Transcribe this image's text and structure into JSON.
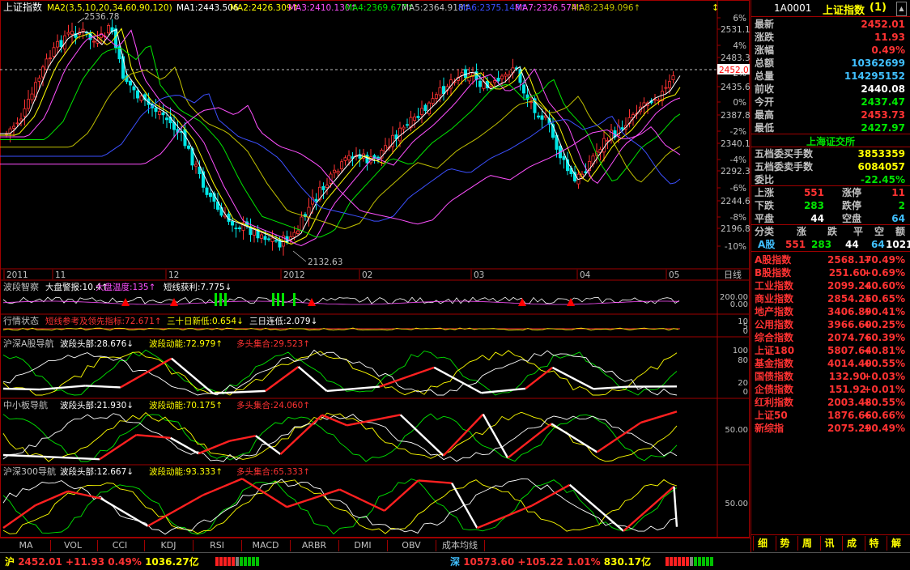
{
  "chart_title": "上证指数",
  "ma_legend": [
    {
      "text": "MA2(3,5,10,20,34,60,90,120)",
      "color": "#ffff00"
    },
    {
      "text": "MA1:2443.506",
      "color": "#ffffff"
    },
    {
      "text": "MA2:2426.309↑",
      "color": "#ffff00"
    },
    {
      "text": "MA3:2410.130↑",
      "color": "#ff50ff"
    },
    {
      "text": "MA4:2369.677↑",
      "color": "#00e600"
    },
    {
      "text": "MA5:2364.918↑",
      "color": "#c0c0c0"
    },
    {
      "text": "MA6:2375.148↑",
      "color": "#3c50ff"
    },
    {
      "text": "MA7:2326.574↑",
      "color": "#ff50ff"
    },
    {
      "text": "MA8:2349.096↑",
      "color": "#c0c000"
    }
  ],
  "price_labels": {
    "high": "2536.78",
    "low": "2132.63",
    "current": "2452.0"
  },
  "right_axis": [
    "6%",
    "2531.1",
    "4%",
    "2483.3",
    "2%",
    "2435.6",
    "0%",
    "2387.8",
    "-2%",
    "2340.1",
    "-4%",
    "2292.3",
    "-6%",
    "2244.6",
    "-8%",
    "2196.8",
    "-10%"
  ],
  "x_labels": [
    "2011",
    "11",
    "12",
    "2012",
    "02",
    "03",
    "04",
    "05"
  ],
  "timeframe": "日线",
  "indicators": [
    {
      "title": "波段智察",
      "items": [
        {
          "t": "大盘警报:10.4↑",
          "c": "#ffffff"
        },
        {
          "t": "大盘温度:135↑",
          "c": "#ff50ff"
        },
        {
          "t": "短线获利:7.775↓",
          "c": "#ffffff"
        }
      ],
      "axis": [
        "200.00",
        "0.00"
      ]
    },
    {
      "title": "行情状态",
      "items": [
        {
          "t": "短线参考及领先指标:72.671↑",
          "c": "#ff3232"
        },
        {
          "t": "三十日新低:0.654↓",
          "c": "#ffff00"
        },
        {
          "t": "三日连低:2.079↓",
          "c": "#ffffff"
        }
      ],
      "axis": [
        "10",
        "5",
        "0"
      ]
    },
    {
      "title": "沪深A股导航",
      "items": [
        {
          "t": "波段头部:28.676↓",
          "c": "#ffffff"
        },
        {
          "t": "波段动能:72.979↑",
          "c": "#ffff00"
        },
        {
          "t": "多头集合:29.523↑",
          "c": "#ff3232"
        }
      ],
      "axis": [
        "100",
        "80",
        "20",
        "0"
      ]
    },
    {
      "title": "中小板导航",
      "items": [
        {
          "t": "波段头部:21.930↓",
          "c": "#ffffff"
        },
        {
          "t": "波段动能:70.175↑",
          "c": "#ffff00"
        },
        {
          "t": "多头集合:24.060↑",
          "c": "#ff3232"
        }
      ],
      "axis": [
        "50.00"
      ]
    },
    {
      "title": "沪深300导航",
      "items": [
        {
          "t": "波段头部:12.667↓",
          "c": "#ffffff"
        },
        {
          "t": "波段动能:93.333↑",
          "c": "#ffff00"
        },
        {
          "t": "多头集合:65.333↑",
          "c": "#ff3232"
        }
      ],
      "axis": [
        "50.00"
      ]
    }
  ],
  "tabs": [
    "MA",
    "VOL",
    "CCI",
    "KDJ",
    "RSI",
    "MACD",
    "ARBR",
    "DMI",
    "OBV",
    "成本均线"
  ],
  "panel": {
    "code": "1A0001",
    "name": "上证指数",
    "suffix": "(1)",
    "quote": [
      {
        "label": "最新",
        "value": "2452.01",
        "color": "#ff3232"
      },
      {
        "label": "涨跌",
        "value": "11.93",
        "color": "#ff3232"
      },
      {
        "label": "涨幅",
        "value": "0.49%",
        "color": "#ff3232"
      },
      {
        "label": "总额",
        "value": "10362699",
        "color": "#40c0ff"
      },
      {
        "label": "总量",
        "value": "114295152",
        "color": "#40c0ff"
      },
      {
        "label": "前收",
        "value": "2440.08",
        "color": "#ffffff"
      },
      {
        "label": "今开",
        "value": "2437.47",
        "color": "#00e600"
      },
      {
        "label": "最高",
        "value": "2453.73",
        "color": "#ff3232"
      },
      {
        "label": "最低",
        "value": "2427.97",
        "color": "#00e600"
      }
    ],
    "exchange": "上海证交所",
    "orders": [
      {
        "label": "五档委买手数",
        "value": "3853359",
        "color": "#ffff00"
      },
      {
        "label": "五档委卖手数",
        "value": "6084057",
        "color": "#ffff00"
      },
      {
        "label": "委比",
        "value": "-22.45%",
        "color": "#00e600"
      }
    ],
    "breadth": [
      {
        "l1": "上涨",
        "v1": "551",
        "c1": "#ff3232",
        "l2": "涨停",
        "v2": "11",
        "c2": "#ff3232"
      },
      {
        "l1": "下跌",
        "v1": "283",
        "c1": "#00e600",
        "l2": "跌停",
        "v2": "2",
        "c2": "#00e600"
      },
      {
        "l1": "平盘",
        "v1": "44",
        "c1": "#ffffff",
        "l2": "空盘",
        "v2": "64",
        "c2": "#40c0ff"
      }
    ],
    "cat_header": [
      "分类",
      "涨",
      "跌",
      "平",
      "空",
      "额"
    ],
    "cat_row": {
      "name": "A股",
      "up": "551",
      "down": "283",
      "flat": "44",
      "empty": "64",
      "amt": "1021"
    },
    "indices": [
      {
        "n": "A股指数",
        "v": "2568.17",
        "p": "+0.49%"
      },
      {
        "n": "B股指数",
        "v": "251.60",
        "p": "+0.69%"
      },
      {
        "n": "工业指数",
        "v": "2099.24",
        "p": "+0.60%"
      },
      {
        "n": "商业指数",
        "v": "2854.25",
        "p": "+0.65%"
      },
      {
        "n": "地产指数",
        "v": "3406.89",
        "p": "+0.41%"
      },
      {
        "n": "公用指数",
        "v": "3966.60",
        "p": "+0.25%"
      },
      {
        "n": "综合指数",
        "v": "2074.76",
        "p": "+0.39%"
      },
      {
        "n": "上证180",
        "v": "5807.64",
        "p": "+0.81%"
      },
      {
        "n": "基金指数",
        "v": "4014.40",
        "p": "+0.55%"
      },
      {
        "n": "国债指数",
        "v": "132.90",
        "p": "+0.03%"
      },
      {
        "n": "企债指数",
        "v": "151.92",
        "p": "+0.01%"
      },
      {
        "n": "红利指数",
        "v": "2003.48",
        "p": "+0.55%"
      },
      {
        "n": "上证50",
        "v": "1876.66",
        "p": "+0.66%"
      },
      {
        "n": "新综指",
        "v": "2075.29",
        "p": "+0.49%"
      }
    ],
    "bottom_tabs": [
      "细",
      "势",
      "周",
      "讯",
      "成",
      "特",
      "解"
    ]
  },
  "status": {
    "sh": {
      "name": "沪",
      "price": "2452.01",
      "chg": "+11.93",
      "pct": "0.49%",
      "amt": "1036.27亿"
    },
    "sz": {
      "name": "深",
      "price": "10573.60",
      "chg": "+105.22",
      "pct": "1.01%",
      "amt": "830.17亿"
    }
  }
}
